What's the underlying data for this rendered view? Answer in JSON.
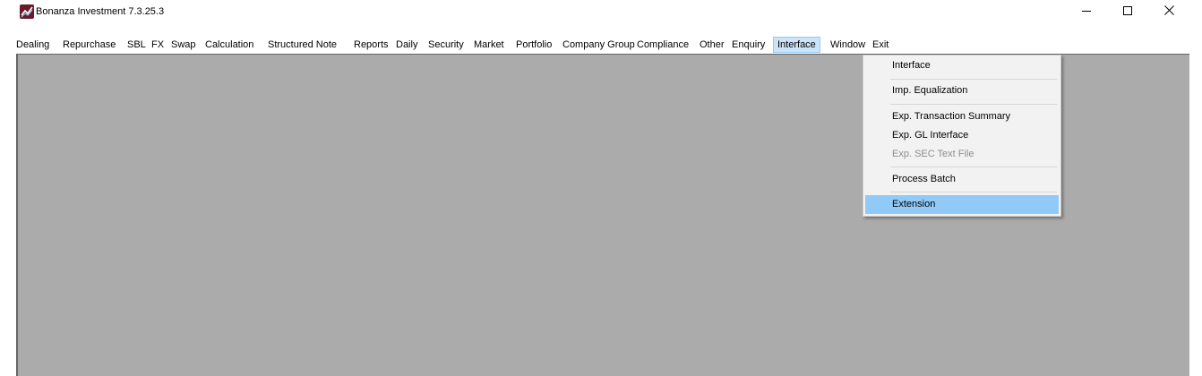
{
  "window": {
    "title": "Bonanza Investment 7.3.25.3",
    "icon": "app-chart-icon",
    "controls": [
      "minimize-icon",
      "maximize-icon",
      "close-icon"
    ]
  },
  "menubar": {
    "items": [
      "Dealing",
      "Repurchase",
      "SBL",
      "FX",
      "Swap",
      "Calculation",
      "Structured Note",
      "Reports",
      "Daily",
      "Security",
      "Market",
      "Portfolio",
      "Company Group",
      "Compliance",
      "Other",
      "Enquiry",
      "Interface",
      "Window",
      "Exit"
    ],
    "active": "Interface"
  },
  "interface_menu": {
    "items": [
      {
        "label": "Interface",
        "enabled": true
      },
      {
        "label": "Imp. Equalization",
        "enabled": true
      },
      {
        "label": "Exp. Transaction Summary",
        "enabled": true
      },
      {
        "label": "Exp. GL Interface",
        "enabled": true
      },
      {
        "label": "Exp. SEC Text File",
        "enabled": false
      },
      {
        "label": "Process Batch",
        "enabled": true
      },
      {
        "label": "Extension",
        "enabled": true,
        "highlighted": true
      }
    ]
  },
  "colors": {
    "workspace": "#ababab",
    "menu_highlight": "#91c9f7",
    "active_menu": "#cce4f7"
  }
}
